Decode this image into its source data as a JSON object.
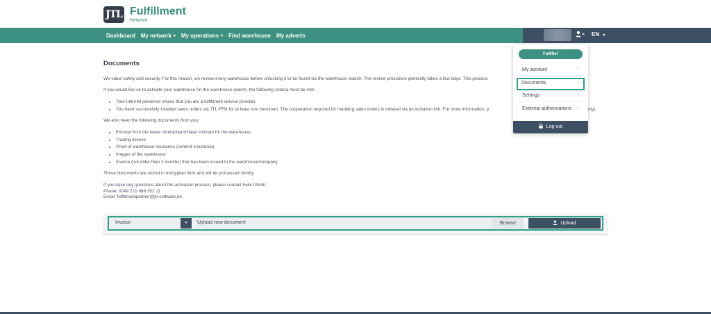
{
  "brand": {
    "logo_mark": "JTL",
    "title": "Fulfillment",
    "subtitle": "Network"
  },
  "nav": {
    "items": [
      {
        "label": "Dashboard",
        "dropdown": false
      },
      {
        "label": "My network",
        "dropdown": true
      },
      {
        "label": "My operations",
        "dropdown": true
      },
      {
        "label": "Find warehouse",
        "dropdown": false
      },
      {
        "label": "My adverts",
        "dropdown": false
      }
    ],
    "language": "EN",
    "caret": "⌄"
  },
  "user_menu": {
    "badge": "Fulfiller",
    "items": [
      {
        "label": "My account"
      },
      {
        "label": "Documents"
      },
      {
        "label": "Settings"
      },
      {
        "label": "External authorisations"
      }
    ],
    "logout": "Log out",
    "chevron": "›"
  },
  "page": {
    "title": "Documents",
    "intro": "We value safety and security. For this reason, we review every warehouse before unlocking it to be found via the warehouse search. The review procedure generally takes a few days. This process",
    "criteria_intro": "If you would like us to activate your warehouse for the warehouse search, the following criteria must be met:",
    "criteria": [
      "Your Internet presence shows that you are a fulfillment service provider.",
      "You have successfully handled sales orders via JTL-FFN for at least one merchant. The cooperation required for handling sales orders is initiated via an invitation link. For more information, p"
    ],
    "criteria_tail": "nly).",
    "docs_intro": "We also need the following documents from you:",
    "docs": [
      "Excerpt from the lease contract/purchase contract for the warehouse",
      "Trading licence",
      "Proof of warehouse insurance (content insurance)",
      "Images of the warehouse",
      "Invoice (not older than 3 months) that has been issued to the warehouse/company"
    ],
    "stored_note": "These documents are stored in encrypted form and will be processed shortly.",
    "contact_intro": "If you have any questions about the activation process, please contact Felix Ullrich:",
    "phone": "Phone: 0049 221 988 302 11",
    "email": "Email: fulfillmentpartner@jtl-software.de"
  },
  "upload": {
    "doc_type": "Invoice",
    "placeholder": "Upload new document",
    "browse": "Browse",
    "button": "Upload"
  },
  "colors": {
    "accent": "#3d9182",
    "dark": "#3d4f62",
    "highlight": "#2d9e8a"
  },
  "icons": [
    "user-icon",
    "lock-icon",
    "upload-icon",
    "chevron-right-icon",
    "chevron-down-icon"
  ]
}
